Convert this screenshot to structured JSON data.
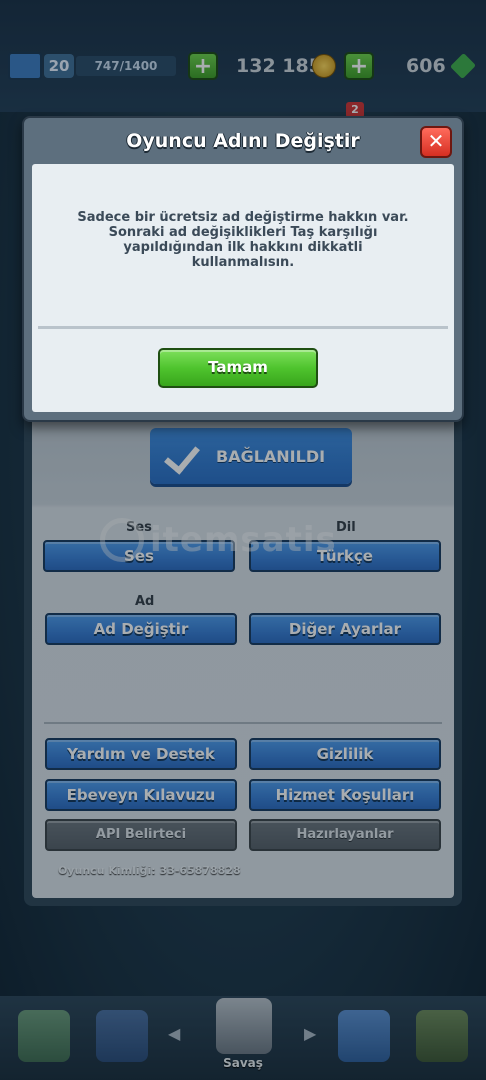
{
  "hud": {
    "level": "20",
    "xp": "747/1400",
    "gold": "132 185",
    "gems": "606",
    "notification_count": "2"
  },
  "modal": {
    "title": "Oyuncu Adını Değiştir",
    "message": "Sadece bir ücretsiz ad değiştirme hakkın var. Sonraki ad değişiklikleri Taş karşılığı yapıldığından ilk hakkını dikkatli kullanmalısın.",
    "ok_label": "Tamam",
    "close_symbol": "✕"
  },
  "settings": {
    "connected_label": "BAĞLANILDI",
    "sound_section": "Ses",
    "sound_button": "Ses",
    "language_section": "Dil",
    "language_button": "Türkçe",
    "name_section": "Ad",
    "change_name_button": "Ad Değiştir",
    "other_settings_button": "Diğer Ayarlar",
    "help_button": "Yardım ve Destek",
    "privacy_button": "Gizlilik",
    "parents_guide_button": "Ebeveyn Kılavuzu",
    "terms_button": "Hizmet Koşulları",
    "api_token_button": "API Belirteci",
    "credits_button": "Hazırlayanlar",
    "player_id": "Oyuncu Kimliği: 33-65878828"
  },
  "watermark": "itemsatis",
  "bottom_nav": {
    "battle_label": "Savaş"
  }
}
